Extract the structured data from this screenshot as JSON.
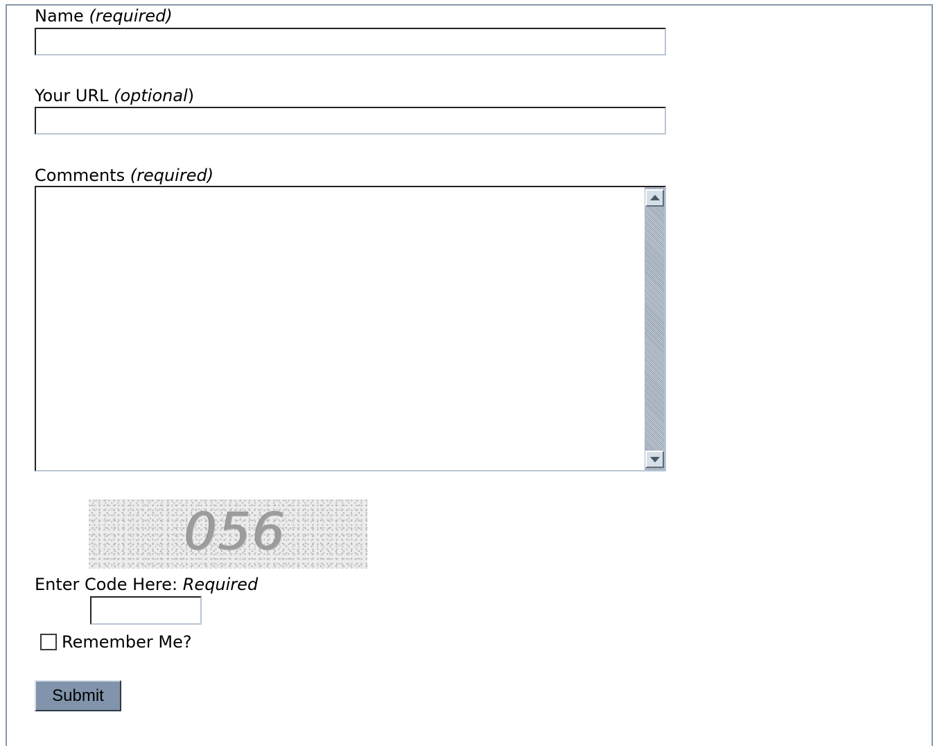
{
  "form": {
    "name": {
      "label": "Name ",
      "note": "(required)",
      "value": ""
    },
    "url": {
      "label": "Your URL ",
      "note": "(optional",
      "suffix": ")",
      "value": ""
    },
    "comments": {
      "label": "Comments ",
      "note": "(required)",
      "value": ""
    },
    "captcha": {
      "code": "056",
      "label": "Enter Code Here: ",
      "note": "Required",
      "value": ""
    },
    "remember": {
      "label": "Remember Me?",
      "checked": false
    },
    "submit_label": "Submit"
  },
  "colors": {
    "frame_border": "#8797a8",
    "button_bg": "#8194ab",
    "scrollbar_track": "#b3bfcc"
  }
}
